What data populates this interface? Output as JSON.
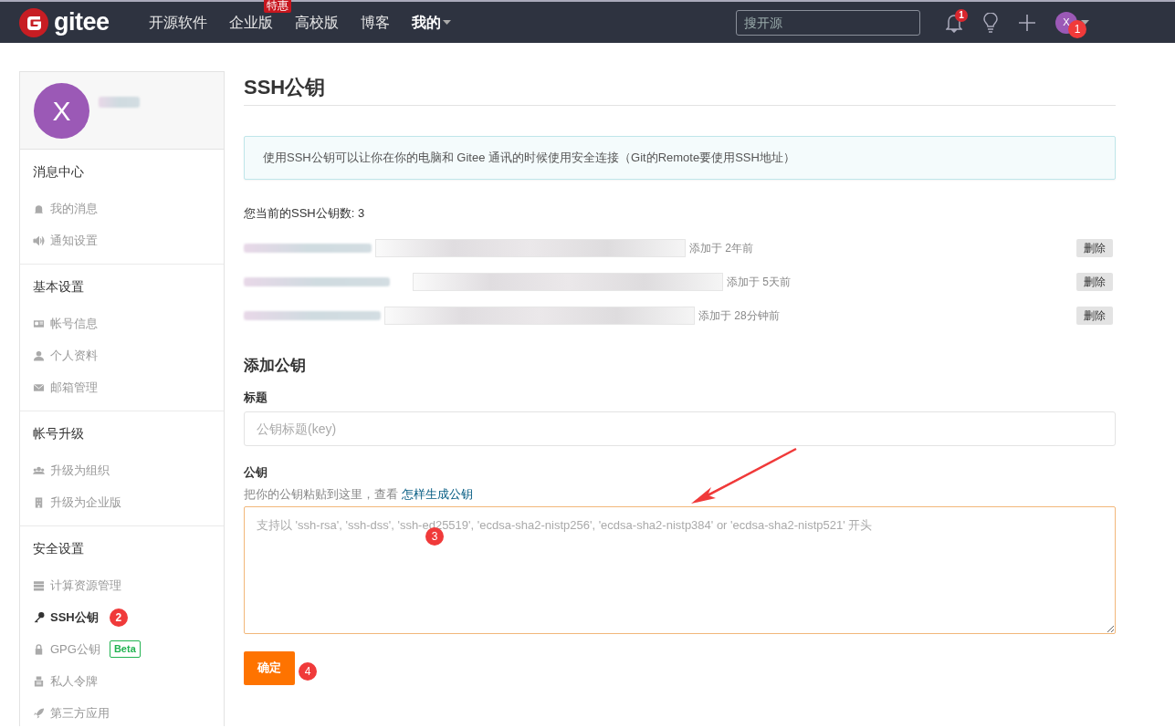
{
  "navbar": {
    "logo": "gitee",
    "links": [
      {
        "label": "开源软件",
        "dropdown": false
      },
      {
        "label": "企业版",
        "badge": "特惠",
        "dropdown": false
      },
      {
        "label": "高校版",
        "dropdown": false
      },
      {
        "label": "博客",
        "dropdown": false
      },
      {
        "label": "我的",
        "dropdown": true
      }
    ],
    "search": {
      "placeholder": "搜开源"
    },
    "notification_count": "1",
    "avatar_letter": "X"
  },
  "sidebar": {
    "avatar_letter": "X",
    "sections": [
      {
        "title": "消息中心",
        "items": [
          {
            "label": "我的消息",
            "selected": false
          },
          {
            "label": "通知设置",
            "selected": false
          }
        ]
      },
      {
        "title": "基本设置",
        "items": [
          {
            "label": "帐号信息",
            "selected": false
          },
          {
            "label": "个人资料",
            "selected": false
          },
          {
            "label": "邮箱管理",
            "selected": false
          }
        ]
      },
      {
        "title": "帐号升级",
        "items": [
          {
            "label": "升级为组织",
            "selected": false
          },
          {
            "label": "升级为企业版",
            "selected": false
          }
        ]
      },
      {
        "title": "安全设置",
        "items": [
          {
            "label": "计算资源管理",
            "selected": false
          },
          {
            "label": "SSH公钥",
            "selected": true
          },
          {
            "label": "GPG公钥",
            "selected": false,
            "tag": "Beta"
          },
          {
            "label": "私人令牌",
            "selected": false
          },
          {
            "label": "第三方应用",
            "selected": false
          }
        ]
      }
    ]
  },
  "main": {
    "title": "SSH公钥",
    "notice": "使用SSH公钥可以让你在你的电脑和 Gitee 通讯的时候使用安全连接（Git的Remote要使用SSH地址）",
    "key_count": "您当前的SSH公钥数: 3",
    "keys": [
      {
        "added": "添加于 2年前",
        "delete_label": "删除"
      },
      {
        "added": "添加于 5天前",
        "delete_label": "删除"
      },
      {
        "added": "添加于 28分钟前",
        "delete_label": "删除"
      }
    ],
    "add_heading": "添加公钥",
    "title_label": "标题",
    "title_placeholder": "公钥标题(key)",
    "key_label": "公钥",
    "key_help": "把你的公钥粘贴到这里，查看",
    "key_help_link": "怎样生成公钥",
    "key_placeholder": "支持以 'ssh-rsa', 'ssh-dss', 'ssh-ed25519', 'ecdsa-sha2-nistp256', 'ecdsa-sha2-nistp384' or 'ecdsa-sha2-nistp521' 开头",
    "submit_label": "确定"
  },
  "annotations": [
    {
      "label": "1"
    },
    {
      "label": "2"
    },
    {
      "label": "3"
    },
    {
      "label": "4"
    }
  ]
}
